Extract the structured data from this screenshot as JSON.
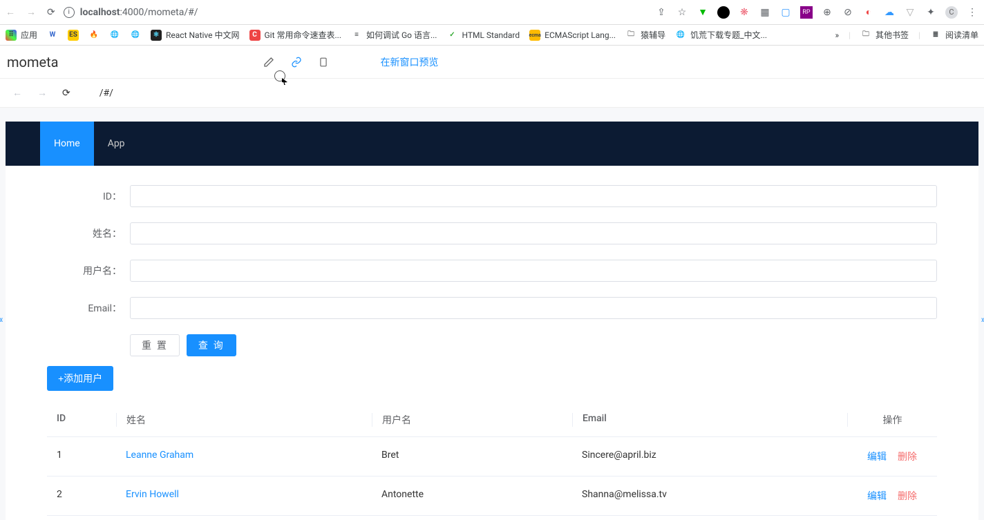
{
  "chrome": {
    "url_host": "localhost",
    "url_port": ":4000",
    "url_path": "/mometa/#/"
  },
  "bookmarks": {
    "apps": "应用",
    "items": [
      {
        "label": "W"
      },
      {
        "label": "ES"
      },
      {
        "label": ""
      },
      {
        "label": ""
      },
      {
        "label": ""
      },
      {
        "label": "React Native 中文网"
      },
      {
        "label": "Git 常用命令速查表..."
      },
      {
        "label": "如何调试 Go 语言..."
      },
      {
        "label": "HTML Standard"
      },
      {
        "label": "ECMAScript Lang..."
      },
      {
        "label": "猿辅导"
      },
      {
        "label": "饥荒下载专题_中文..."
      }
    ],
    "more": "»",
    "other": "其他书签",
    "reading": "阅读清单"
  },
  "app": {
    "title": "mometa",
    "preview": "在新窗口预览",
    "inner_url": "/#/"
  },
  "page": {
    "nav": {
      "home": "Home",
      "app": "App"
    },
    "form": {
      "id_label": "ID：",
      "name_label": "姓名：",
      "user_label": "用户名：",
      "email_label": "Email：",
      "reset": "重 置",
      "query": "查 询",
      "add_user": "添加用户"
    },
    "table": {
      "headers": {
        "id": "ID",
        "name": "姓名",
        "user": "用户名",
        "email": "Email",
        "op": "操作"
      },
      "rows": [
        {
          "id": "1",
          "name": "Leanne Graham",
          "user": "Bret",
          "email": "Sincere@april.biz"
        },
        {
          "id": "2",
          "name": "Ervin Howell",
          "user": "Antonette",
          "email": "Shanna@melissa.tv"
        }
      ],
      "edit": "编辑",
      "delete": "删除"
    }
  }
}
